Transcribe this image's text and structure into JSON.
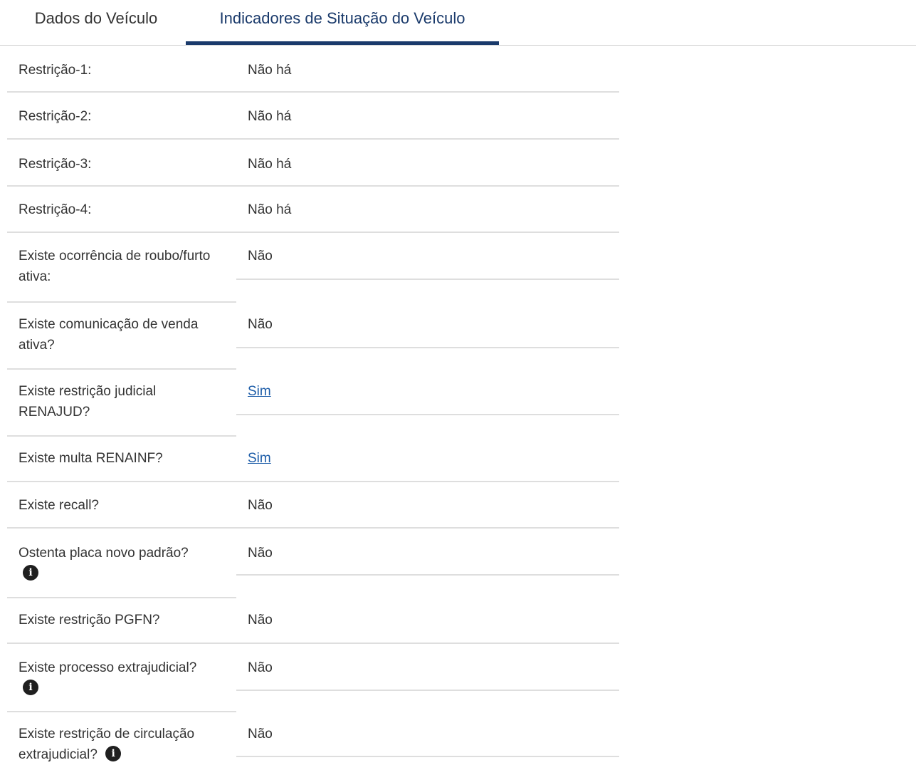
{
  "tabs": [
    {
      "label": "Dados do Veículo",
      "active": false
    },
    {
      "label": "Indicadores de Situação do Veículo",
      "active": true
    }
  ],
  "rows": [
    {
      "label": "Restrição-1:",
      "value": "Não há",
      "link": false
    },
    {
      "label": "Restrição-2:",
      "value": "Não há",
      "link": false
    },
    {
      "label": "Restrição-3:",
      "value": "Não há",
      "link": false
    },
    {
      "label": "Restrição-4:",
      "value": "Não há",
      "link": false
    },
    {
      "label": "Existe ocorrência de roubo/furto ativa:",
      "value": "Não",
      "link": false
    },
    {
      "label": "Existe comunicação de venda ativa?",
      "value": "Não",
      "link": false
    },
    {
      "label": "Existe restrição judicial RENAJUD?",
      "value": "Sim",
      "link": true
    },
    {
      "label": "Existe multa RENAINF?",
      "value": "Sim",
      "link": true
    },
    {
      "label": "Existe recall?",
      "value": "Não",
      "link": false
    },
    {
      "label": "Ostenta placa novo padrão?",
      "value": "Não",
      "link": false,
      "info_icon": true
    },
    {
      "label": "Existe restrição PGFN?",
      "value": "Não",
      "link": false
    },
    {
      "label": "Existe processo extrajudicial?",
      "value": "Não",
      "link": false,
      "info_icon": true
    },
    {
      "label": "Existe restrição de circulação extrajudicial?",
      "value": "Não",
      "link": false,
      "info_icon": true
    }
  ],
  "info_icon_glyph": "i",
  "colors": {
    "accent": "#1a3a6b",
    "link": "#1c5ca8"
  }
}
